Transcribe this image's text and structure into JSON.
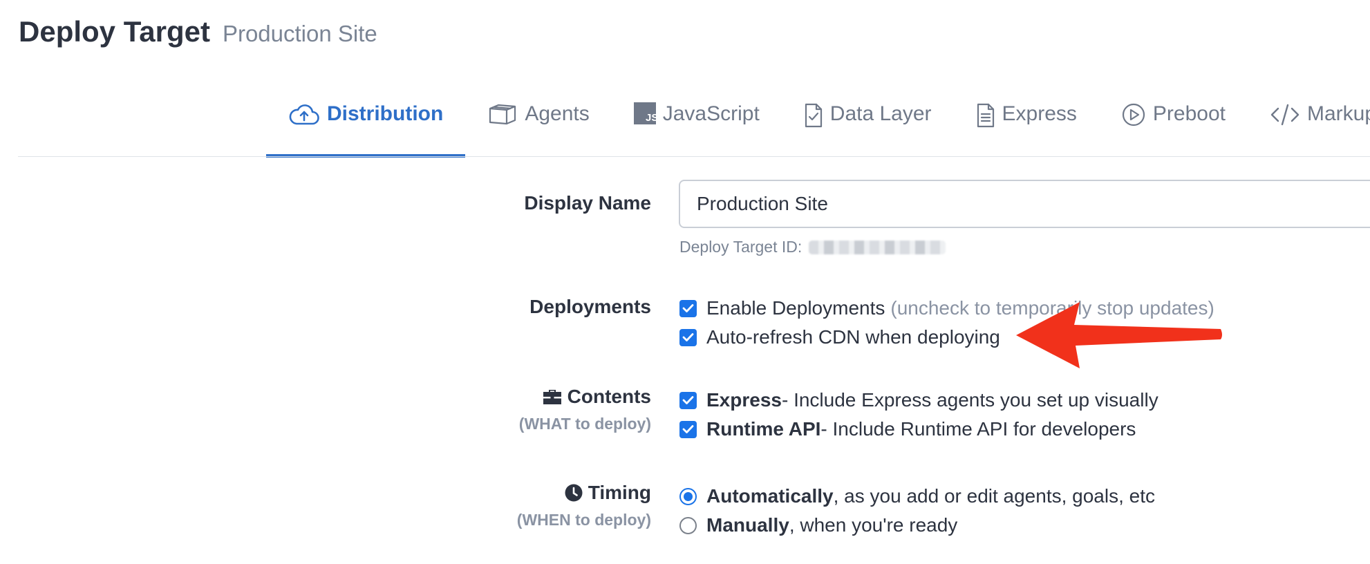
{
  "header": {
    "title": "Deploy Target",
    "subtitle": "Production Site"
  },
  "tabs": [
    {
      "label": "Distribution",
      "icon": "cloud-upload-icon",
      "active": true
    },
    {
      "label": "Agents",
      "icon": "box-icon",
      "active": false
    },
    {
      "label": "JavaScript",
      "icon": "js-icon",
      "icon_text": "JS",
      "active": false
    },
    {
      "label": "Data Layer",
      "icon": "file-check-icon",
      "active": false
    },
    {
      "label": "Express",
      "icon": "file-text-icon",
      "active": false
    },
    {
      "label": "Preboot",
      "icon": "play-circle-icon",
      "active": false
    },
    {
      "label": "Markup",
      "icon": "code-icon",
      "active": false
    }
  ],
  "form": {
    "display_name": {
      "label": "Display Name",
      "value": "Production Site",
      "hint_label": "Deploy Target ID:"
    },
    "deployments": {
      "label": "Deployments",
      "options": [
        {
          "label": "Enable Deployments",
          "note": "(uncheck to temporarily stop updates)",
          "checked": true
        },
        {
          "label": "Auto-refresh CDN when deploying",
          "checked": true
        }
      ]
    },
    "contents": {
      "label": "Contents",
      "sublabel": "(WHAT to deploy)",
      "icon": "briefcase-icon",
      "options": [
        {
          "bold": "Express",
          "text": " - Include Express agents you set up visually",
          "checked": true
        },
        {
          "bold": "Runtime API",
          "text": " - Include Runtime API for developers",
          "checked": true
        }
      ]
    },
    "timing": {
      "label": "Timing",
      "sublabel": "(WHEN to deploy)",
      "icon": "clock-icon",
      "options": [
        {
          "bold": "Automatically",
          "text": ", as you add or edit agents, goals, etc",
          "selected": true
        },
        {
          "bold": "Manually",
          "text": ", when you're ready",
          "selected": false
        }
      ]
    }
  },
  "colors": {
    "accent": "#2e6fc8",
    "checkbox": "#1a73e8",
    "annotation_arrow": "#f1311b",
    "muted_text": "#8a93a3"
  }
}
